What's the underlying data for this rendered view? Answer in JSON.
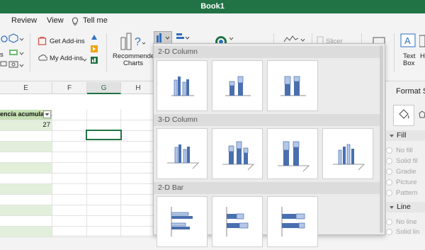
{
  "window": {
    "title": "Book1"
  },
  "menu": {
    "review": "Review",
    "view": "View",
    "tell_me": "Tell me"
  },
  "ribbon": {
    "get_addins": "Get Add-ins",
    "my_addins": "My Add-ins",
    "recommended_charts_line1": "Recommended",
    "recommended_charts_line2": "Charts",
    "slicer": "Slicer",
    "text_box_line1": "Text",
    "text_box_line2": "Box",
    "partial_label": "s",
    "partial_label2": "H",
    "partial_label3": "&"
  },
  "sheet": {
    "columns": [
      "E",
      "F",
      "G",
      "H"
    ],
    "selected_column": "G",
    "header_cell": "encia acumulada",
    "value_cell": "27"
  },
  "chart_menu": {
    "sections": [
      {
        "title": "2-D Column"
      },
      {
        "title": "3-D Column"
      },
      {
        "title": "2-D Bar"
      }
    ]
  },
  "format_pane": {
    "title": "Format S",
    "fill_section": "Fill",
    "fill_options": [
      "No fill",
      "Solid fil",
      "Gradie",
      "Picture",
      "Pattern"
    ],
    "line_section": "Line",
    "line_options": [
      "No line",
      "Solid lin"
    ]
  }
}
